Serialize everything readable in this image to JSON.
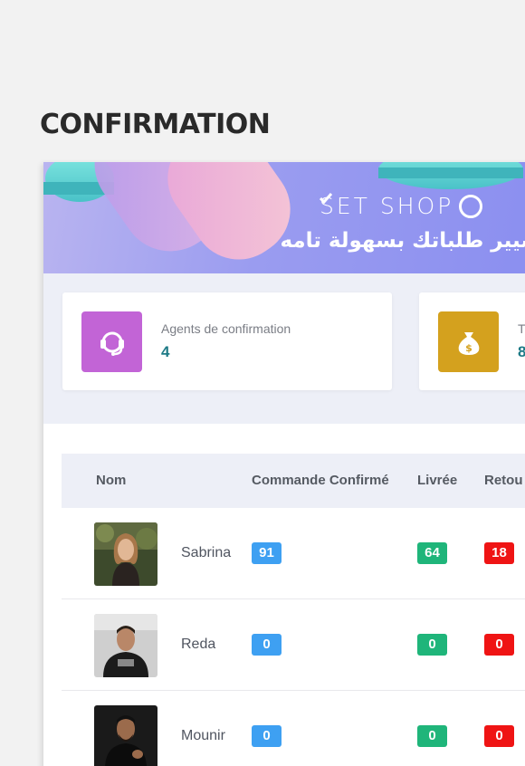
{
  "page": {
    "title": "CONFIRMATION"
  },
  "banner": {
    "brand": "SET SHOP",
    "tagline": "سيير طلباتك بسهولة تامه"
  },
  "stats": [
    {
      "label": "Agents de confirmation",
      "value": "4",
      "icon": "headset-icon",
      "color": "#c264d6"
    },
    {
      "label": "T",
      "value": "8",
      "icon": "money-bag-icon",
      "color": "#d4a11e"
    }
  ],
  "table": {
    "columns": [
      "Nom",
      "Commande Confirmé",
      "Livrée",
      "Retou"
    ],
    "rows": [
      {
        "name": "Sabrina",
        "confirmed": "91",
        "delivered": "64",
        "returned": "18"
      },
      {
        "name": "Reda",
        "confirmed": "0",
        "delivered": "0",
        "returned": "0"
      },
      {
        "name": "Mounir",
        "confirmed": "0",
        "delivered": "0",
        "returned": "0"
      }
    ]
  },
  "colors": {
    "blue_badge": "#3ea0f2",
    "green_badge": "#1fb57a",
    "red_badge": "#ef1414",
    "stat_value": "#1d7a86"
  }
}
